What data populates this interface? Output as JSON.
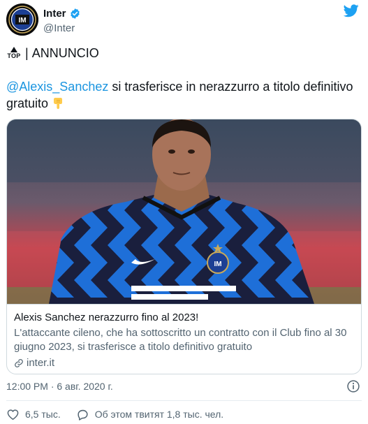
{
  "account": {
    "name": "Inter",
    "handle": "@Inter"
  },
  "tweet": {
    "badge": "TOP",
    "separator": "|",
    "headline": "ANNUNCIO",
    "mention": "@Alexis_Sanchez",
    "body": " si trasferisce in nerazzurro a titolo definitivo gratuito"
  },
  "card": {
    "title": "Alexis Sanchez nerazzurro fino al 2023!",
    "description": "L'attaccante cileno, che ha sottoscritto un contratto con il Club fino al 30 giugno 2023, si trasferisce a titolo definitivo gratuito",
    "domain": "inter.it"
  },
  "meta": {
    "timestamp": "12:00 PM · 6 авг. 2020 г."
  },
  "actions": {
    "likes": "6,5 тыс.",
    "discussing": "Об этом твитят 1,8 тыс. чел."
  },
  "colors": {
    "link": "#1b95e0",
    "twitter_blue": "#1da1f2",
    "like_icon": "#536471"
  },
  "icons": [
    "inter-logo",
    "verified-badge-icon",
    "twitter-bird-icon",
    "backhand-index-pointing-down-icon",
    "link-icon",
    "info-icon",
    "heart-icon",
    "speech-bubble-icon"
  ]
}
